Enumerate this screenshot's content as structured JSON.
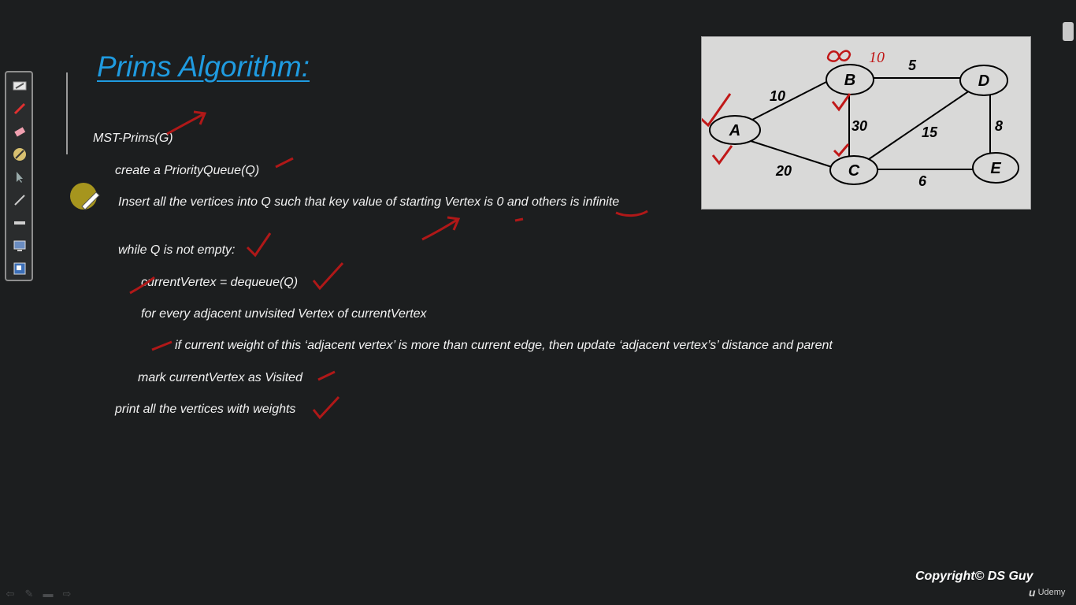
{
  "slide": {
    "title": "Prims Algorithm:",
    "copyright": "Copyright© DS Guy"
  },
  "code_lines": [
    "MST-Prims(G)",
    "create a PriorityQueue(Q)",
    "Insert all the vertices into Q such that key value of starting Vertex is 0 and others is infinite",
    "while Q is not empty:",
    "currentVertex = dequeue(Q)",
    "for every adjacent unvisited Vertex of currentVertex",
    "if current weight of this ‘adjacent vertex’ is more than current edge, then update ‘adjacent vertex’s’ distance and parent",
    "mark currentVertex as Visited",
    "print all the vertices with weights"
  ],
  "graph": {
    "nodes": [
      "A",
      "B",
      "C",
      "D",
      "E"
    ],
    "edges": [
      {
        "from": "A",
        "to": "B",
        "weight": "10"
      },
      {
        "from": "A",
        "to": "C",
        "weight": "20"
      },
      {
        "from": "B",
        "to": "C",
        "weight": "30"
      },
      {
        "from": "B",
        "to": "D",
        "weight": "5"
      },
      {
        "from": "C",
        "to": "D",
        "weight": "15"
      },
      {
        "from": "C",
        "to": "E",
        "weight": "6"
      },
      {
        "from": "D",
        "to": "E",
        "weight": "8"
      }
    ],
    "handwritten_label_b": "10"
  },
  "toolbar": {
    "tools": [
      "highlighter-icon",
      "pen-icon",
      "eraser-icon",
      "compass-icon",
      "pointer-icon",
      "brush-icon",
      "line-icon",
      "screen-icon",
      "screen-color-icon"
    ]
  },
  "branding": {
    "udemy_label": "Udemy"
  },
  "colors": {
    "background": "#1c1e1f",
    "title": "#1f9be0",
    "annotation": "#b01818",
    "graph_panel": "#d9d9d8"
  }
}
